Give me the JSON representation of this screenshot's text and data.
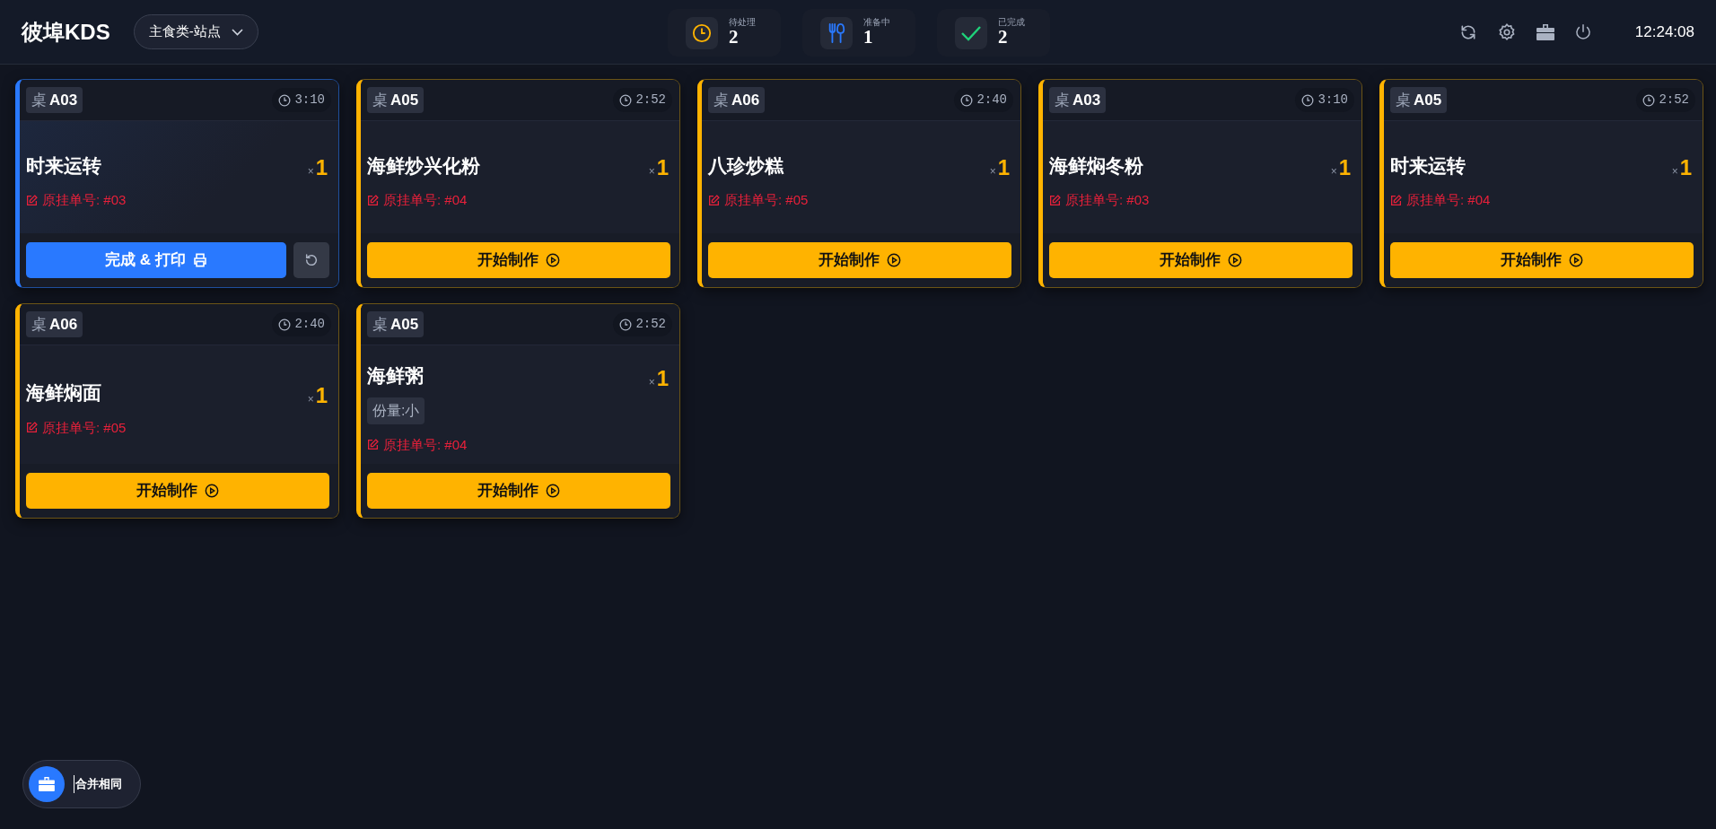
{
  "header": {
    "brand": "彼埠KDS",
    "station": "主食类-站点",
    "stats": [
      {
        "kind": "pending",
        "label": "待处理",
        "count": "2"
      },
      {
        "kind": "preparing",
        "label": "准备中",
        "count": "1"
      },
      {
        "kind": "done",
        "label": "已完成",
        "count": "2"
      }
    ],
    "clock": "12:24:08"
  },
  "orders": [
    {
      "kind": "cooking",
      "table_prefix": "桌",
      "table": "A03",
      "elapsed": "3:10",
      "dish": "时来运转",
      "qty_mark": "×",
      "qty": "1",
      "note": "原挂单号: #03",
      "action": "完成 & 打印"
    },
    {
      "kind": "pending",
      "table_prefix": "桌",
      "table": "A05",
      "elapsed": "2:52",
      "dish": "海鲜炒兴化粉",
      "qty_mark": "×",
      "qty": "1",
      "note": "原挂单号: #04",
      "action": "开始制作"
    },
    {
      "kind": "pending",
      "table_prefix": "桌",
      "table": "A06",
      "elapsed": "2:40",
      "dish": "八珍炒糕",
      "qty_mark": "×",
      "qty": "1",
      "note": "原挂单号: #05",
      "action": "开始制作"
    },
    {
      "kind": "pending",
      "table_prefix": "桌",
      "table": "A03",
      "elapsed": "3:10",
      "dish": "海鲜焖冬粉",
      "qty_mark": "×",
      "qty": "1",
      "note": "原挂单号: #03",
      "action": "开始制作"
    },
    {
      "kind": "pending",
      "table_prefix": "桌",
      "table": "A05",
      "elapsed": "2:52",
      "dish": "时来运转",
      "qty_mark": "×",
      "qty": "1",
      "note": "原挂单号: #04",
      "action": "开始制作"
    },
    {
      "kind": "pending",
      "table_prefix": "桌",
      "table": "A06",
      "elapsed": "2:40",
      "dish": "海鲜焖面",
      "qty_mark": "×",
      "qty": "1",
      "note": "原挂单号: #05",
      "action": "开始制作"
    },
    {
      "kind": "pending",
      "table_prefix": "桌",
      "table": "A05",
      "elapsed": "2:52",
      "dish": "海鲜粥",
      "qty_mark": "×",
      "qty": "1",
      "option": "份量:小",
      "note": "原挂单号: #04",
      "action": "开始制作"
    }
  ],
  "merge_button": {
    "label": "合并相同"
  }
}
